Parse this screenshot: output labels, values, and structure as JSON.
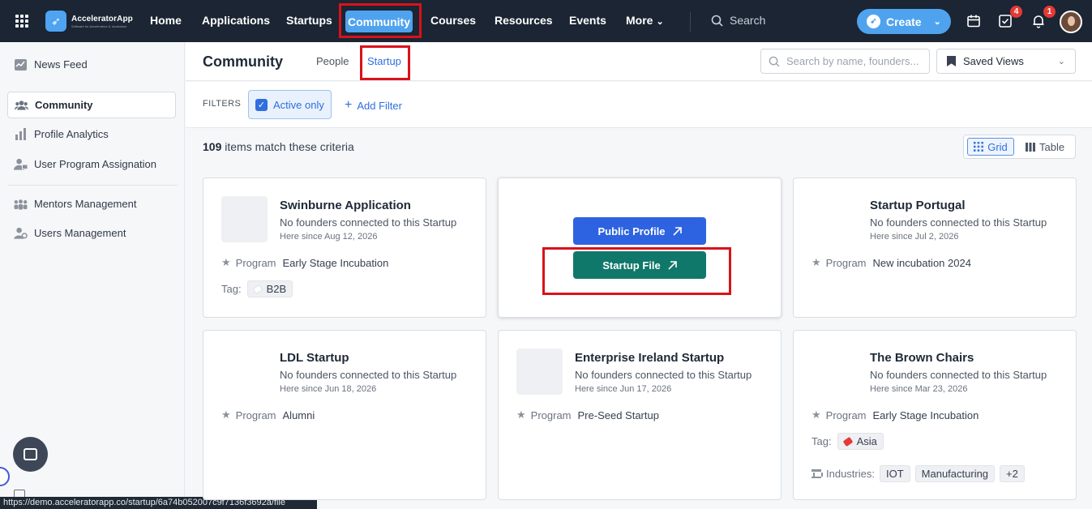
{
  "app": {
    "name": "AcceleratorApp",
    "tagline": "Software for Accelerators & Incubators"
  },
  "nav": {
    "items": [
      "Home",
      "Applications",
      "Startups",
      "Community",
      "Courses",
      "Resources",
      "Events",
      "More"
    ],
    "active": "Community",
    "search_label": "Search",
    "create_label": "Create",
    "tasks_badge": "4",
    "notifications_badge": "1"
  },
  "sidebar": {
    "items": [
      {
        "label": "News Feed",
        "icon": "news-feed-icon"
      },
      {
        "label": "Community",
        "icon": "people-icon",
        "active": true
      },
      {
        "label": "Profile Analytics",
        "icon": "bar-chart-icon"
      },
      {
        "label": "User Program Assignation",
        "icon": "user-assign-icon"
      },
      {
        "label": "Mentors Management",
        "icon": "mentors-icon"
      },
      {
        "label": "Users Management",
        "icon": "users-gear-icon"
      }
    ]
  },
  "page": {
    "title": "Community",
    "tabs": [
      "People",
      "Startup"
    ],
    "active_tab": "Startup",
    "search_placeholder": "Search by name, founders...",
    "saved_views_label": "Saved Views"
  },
  "filters": {
    "label": "FILTERS",
    "active_only_label": "Active only",
    "active_only_checked": true,
    "add_filter_label": "Add Filter"
  },
  "results": {
    "count": "109",
    "suffix": "items match these criteria",
    "view_grid_label": "Grid",
    "view_table_label": "Table"
  },
  "cards": [
    {
      "name": "Swinburne Application",
      "founders": "No founders connected to this Startup",
      "since": "Here since Aug 12, 2026",
      "program_label": "Program",
      "program": "Early Stage Incubation",
      "tag_label": "Tag:",
      "tags": [
        "B2B"
      ]
    },
    {
      "hover_actions": {
        "public_profile": "Public Profile",
        "startup_file": "Startup File"
      }
    },
    {
      "name": "Startup Portugal",
      "founders": "No founders connected to this Startup",
      "since": "Here since Jul 2, 2026",
      "program_label": "Program",
      "program": "New incubation 2024"
    },
    {
      "name": "LDL Startup",
      "founders": "No founders connected to this Startup",
      "since": "Here since Jun 18, 2026",
      "program_label": "Program",
      "program": "Alumni"
    },
    {
      "name": "Enterprise Ireland Startup",
      "founders": "No founders connected to this Startup",
      "since": "Here since Jun 17, 2026",
      "program_label": "Program",
      "program": "Pre-Seed Startup"
    },
    {
      "name": "The Brown Chairs",
      "founders": "No founders connected to this Startup",
      "since": "Here since Mar 23, 2026",
      "program_label": "Program",
      "program": "Early Stage Incubation",
      "tag_label": "Tag:",
      "tags": [
        "Asia"
      ],
      "industries_label": "Industries:",
      "industries": [
        "IOT",
        "Manufacturing",
        "+2"
      ]
    }
  ],
  "colors": {
    "nav_bg": "#1b2533",
    "accent": "#4fa3ee",
    "primary_button": "#2d63e1",
    "file_button": "#10786a",
    "highlight": "#d9121a"
  },
  "status_bar_url": "https://demo.acceleratorapp.co/startup/6a74b052007c9f7136f3692a/file"
}
